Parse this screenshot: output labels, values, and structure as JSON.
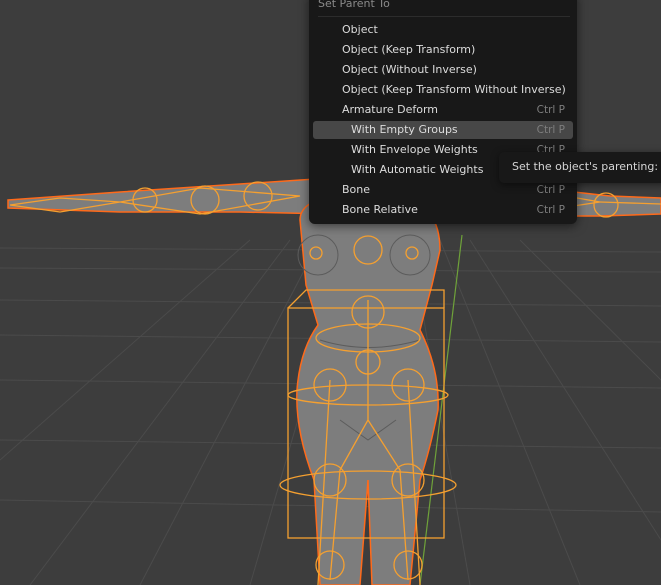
{
  "menu": {
    "title": "Set Parent To",
    "items": [
      {
        "label": "Object",
        "shortcut": "",
        "indent": false,
        "highlight": false
      },
      {
        "label": "Object (Keep Transform)",
        "shortcut": "",
        "indent": false,
        "highlight": false
      },
      {
        "label": "Object (Without Inverse)",
        "shortcut": "",
        "indent": false,
        "highlight": false
      },
      {
        "label": "Object (Keep Transform Without Inverse)",
        "shortcut": "",
        "indent": false,
        "highlight": false
      },
      {
        "label": "Armature Deform",
        "shortcut": "Ctrl P",
        "indent": false,
        "highlight": false
      },
      {
        "label": "With Empty Groups",
        "shortcut": "Ctrl P",
        "indent": true,
        "highlight": true
      },
      {
        "label": "With Envelope Weights",
        "shortcut": "Ctrl P",
        "indent": true,
        "highlight": false
      },
      {
        "label": "With Automatic Weights",
        "shortcut": "",
        "indent": true,
        "highlight": false
      },
      {
        "label": "Bone",
        "shortcut": "Ctrl P",
        "indent": false,
        "highlight": false
      },
      {
        "label": "Bone Relative",
        "shortcut": "Ctrl P",
        "indent": false,
        "highlight": false
      }
    ]
  },
  "tooltip": {
    "text": "Set the object's parenting:"
  },
  "colors": {
    "viewport_bg": "#3d3d3d",
    "grid": "#4a4a4a",
    "mesh": "#7b7b7b",
    "armature": "#f5a030",
    "selection": "#ff6a1a",
    "menu_bg": "#181818",
    "menu_highlight": "#474747"
  }
}
